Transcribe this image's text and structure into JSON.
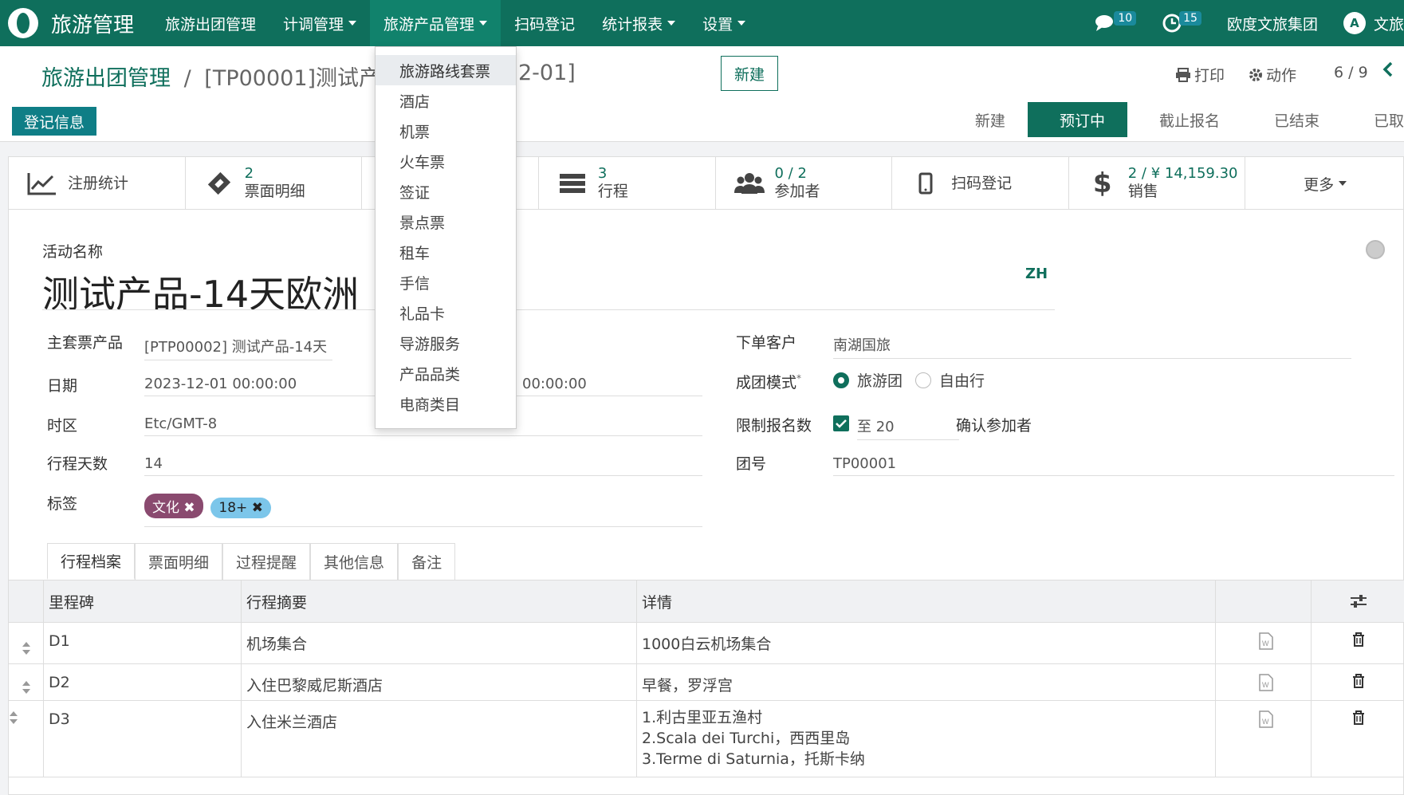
{
  "navbar": {
    "brand": "旅游管理",
    "menu": [
      "旅游出团管理",
      "计调管理",
      "旅游产品管理",
      "扫码登记",
      "统计报表",
      "设置"
    ],
    "messages_count": "10",
    "activities_count": "15",
    "company": "欧度文旅集团",
    "user_avatar": "A",
    "user_name": "文旅"
  },
  "control": {
    "breadcrumb_root": "旅游出团管理",
    "breadcrumb_sep": "/",
    "breadcrumb_current": "[TP00001]测试产品",
    "breadcrumb_current_tail": "2-01]",
    "new_button": "新建",
    "print": "打印",
    "action": "动作",
    "pager": "6 / 9",
    "register_button": "登记信息",
    "stages": [
      "新建",
      "预订中",
      "截止报名",
      "已结束",
      "已取"
    ]
  },
  "smart_buttons": [
    {
      "icon": "chart-line-icon",
      "number": "",
      "label": "注册统计"
    },
    {
      "icon": "ticket-icon",
      "number": "2",
      "label": "票面明细"
    },
    {
      "icon": "blank",
      "number": "",
      "label": ""
    },
    {
      "icon": "itinerary-icon",
      "number": "3",
      "label": "行程"
    },
    {
      "icon": "users-icon",
      "number": "0 / 2",
      "label": "参加者"
    },
    {
      "icon": "mobile-icon",
      "number": "",
      "label": "扫码登记"
    },
    {
      "icon": "dollar-icon",
      "number": "2 / ¥ 14,159.30",
      "label": "销售"
    }
  ],
  "more_label": "更多",
  "form": {
    "name_label": "活动名称",
    "name": "测试产品-14天欧洲",
    "lang": "ZH",
    "main_ticket_label": "主套票产品",
    "main_ticket": "[PTP00002] 测试产品-14天",
    "date_label": "日期",
    "date_start": "2023-12-01 00:00:00",
    "date_end": "00:00:00",
    "tz_label": "时区",
    "tz": "Etc/GMT-8",
    "days_label": "行程天数",
    "days": "14",
    "tags_label": "标签",
    "tags": [
      "文化",
      "18+"
    ],
    "customer_label": "下单客户",
    "customer": "南湖国旅",
    "mode_label": "成团模式",
    "mode_options": [
      "旅游团",
      "自由行"
    ],
    "limit_label": "限制报名数",
    "limit_prefix": "至",
    "limit_value": "20",
    "confirm_label": "确认参加者",
    "group_no_label": "团号",
    "group_no": "TP00001"
  },
  "tabs": [
    "行程档案",
    "票面明细",
    "过程提醒",
    "其他信息",
    "备注"
  ],
  "table": {
    "headers": [
      "里程碑",
      "行程摘要",
      "详情"
    ],
    "rows": [
      {
        "milestone": "D1",
        "summary": "机场集合",
        "details": [
          "1000白云机场集合"
        ]
      },
      {
        "milestone": "D2",
        "summary": "入住巴黎威尼斯酒店",
        "details": [
          "早餐，罗浮宫"
        ]
      },
      {
        "milestone": "D3",
        "summary": "入住米兰酒店",
        "details": [
          "1.利古里亚五渔村",
          "2.Scala dei Turchi，西西里岛",
          "3.Terme di Saturnia，托斯卡纳"
        ]
      }
    ]
  },
  "dropdown": {
    "items": [
      "旅游路线套票",
      "酒店",
      "机票",
      "火车票",
      "签证",
      "景点票",
      "租车",
      "手信",
      "礼品卡",
      "导游服务",
      "产品品类",
      "电商类目"
    ]
  },
  "colors": {
    "primary": "#0f6f5c",
    "tag_culture": "#8a4a6f",
    "tag_age": "#7cc6ea"
  }
}
